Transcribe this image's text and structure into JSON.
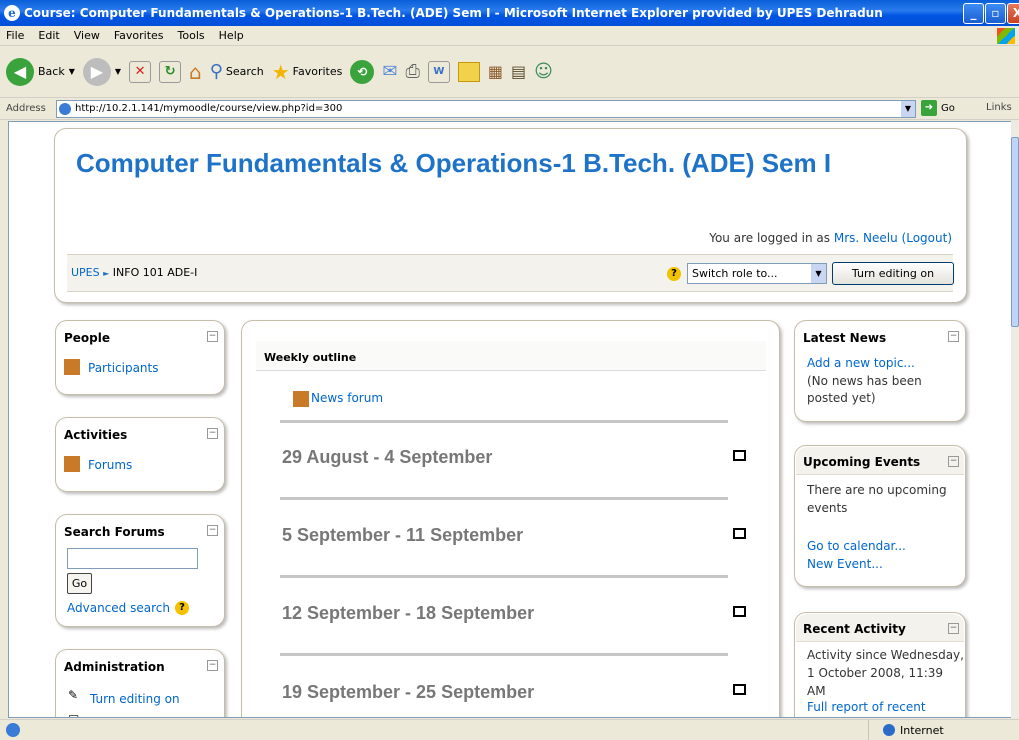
{
  "window": {
    "title": "Course: Computer Fundamentals & Operations-1 B.Tech. (ADE) Sem I - Microsoft Internet Explorer provided by UPES Dehradun",
    "min": "_",
    "max": "▫",
    "close": "X"
  },
  "menu": [
    "File",
    "Edit",
    "View",
    "Favorites",
    "Tools",
    "Help"
  ],
  "toolbar": {
    "back": "Back",
    "search": "Search",
    "favorites": "Favorites"
  },
  "address": {
    "label": "Address",
    "url": "http://10.2.1.141/mymoodle/course/view.php?id=300",
    "go": "Go",
    "links": "Links"
  },
  "header": {
    "course_title": "Computer Fundamentals & Operations-1 B.Tech. (ADE) Sem I",
    "logged_prefix": "You are logged in as",
    "user": "Mrs. Neelu",
    "logout": "(Logout)",
    "breadcrumb_home": "UPES",
    "breadcrumb_sep": "►",
    "breadcrumb_course": "INFO 101 ADE-I",
    "switch_role": "Switch role to...",
    "turn_editing": "Turn editing on"
  },
  "left": {
    "people": {
      "title": "People",
      "participants": "Participants"
    },
    "activities": {
      "title": "Activities",
      "forums": "Forums"
    },
    "search": {
      "title": "Search Forums",
      "go": "Go",
      "advanced": "Advanced search"
    },
    "admin": {
      "title": "Administration",
      "turn_editing": "Turn editing on"
    }
  },
  "center": {
    "outline_title": "Weekly outline",
    "news_forum": "News forum",
    "weeks": [
      "29 August - 4 September",
      "5 September - 11 September",
      "12 September - 18 September",
      "19 September - 25 September"
    ]
  },
  "right": {
    "news": {
      "title": "Latest News",
      "add_topic": "Add a new topic...",
      "no_news": "(No news has been posted yet)"
    },
    "events": {
      "title": "Upcoming Events",
      "none": "There are no upcoming events",
      "calendar": "Go to calendar...",
      "new_event": "New Event..."
    },
    "recent": {
      "title": "Recent Activity",
      "since": "Activity since Wednesday, 1 October 2008, 11:39 AM",
      "full_report": "Full report of recent"
    }
  },
  "status": {
    "zone": "Internet"
  }
}
